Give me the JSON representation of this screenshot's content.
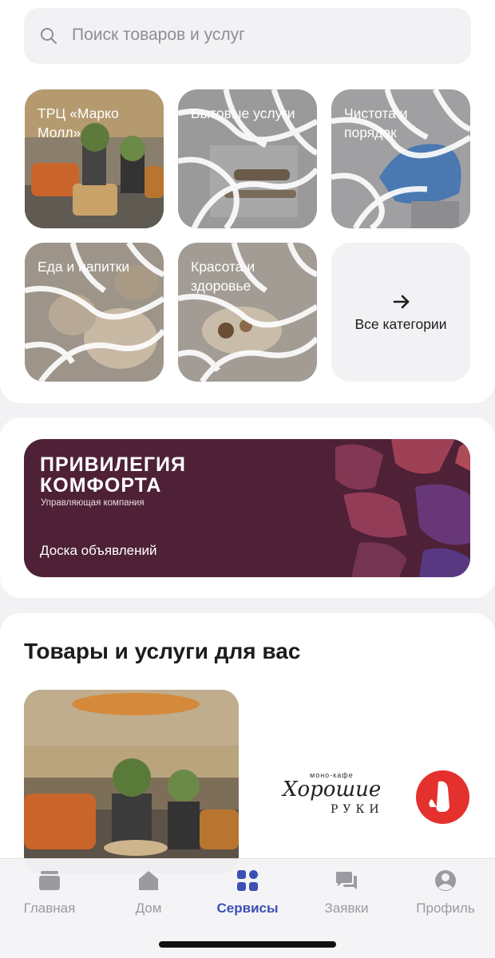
{
  "search": {
    "placeholder": "Поиск товаров и услуг",
    "icon": "search-icon"
  },
  "categories": [
    {
      "label": "ТРЦ «Марко Молл»"
    },
    {
      "label": "Бытовые услуги"
    },
    {
      "label": "Чистота и порядок"
    },
    {
      "label": "Еда и напитки"
    },
    {
      "label": "Красота и здоровье"
    }
  ],
  "all_categories": {
    "label": "Все категории",
    "icon": "arrow-right-icon"
  },
  "banner": {
    "brand_line1": "ПРИВИЛЕГИЯ",
    "brand_line2": "КОМФОРТА",
    "brand_sub": "Управляющая компания",
    "cta": "Доска объявлений",
    "background": "#4e2137"
  },
  "products": {
    "title": "Товары и услуги для вас",
    "logo_top": "моно-кафе",
    "logo_script": "Хорошие",
    "logo_bottom": "РУКИ"
  },
  "tabbar": {
    "items": [
      {
        "label": "Главная",
        "icon": "main-icon"
      },
      {
        "label": "Дом",
        "icon": "house-icon"
      },
      {
        "label": "Сервисы",
        "icon": "services-icon",
        "active": true
      },
      {
        "label": "Заявки",
        "icon": "chat-icon"
      },
      {
        "label": "Профиль",
        "icon": "profile-icon"
      }
    ],
    "active_color": "#3b4fb4"
  }
}
